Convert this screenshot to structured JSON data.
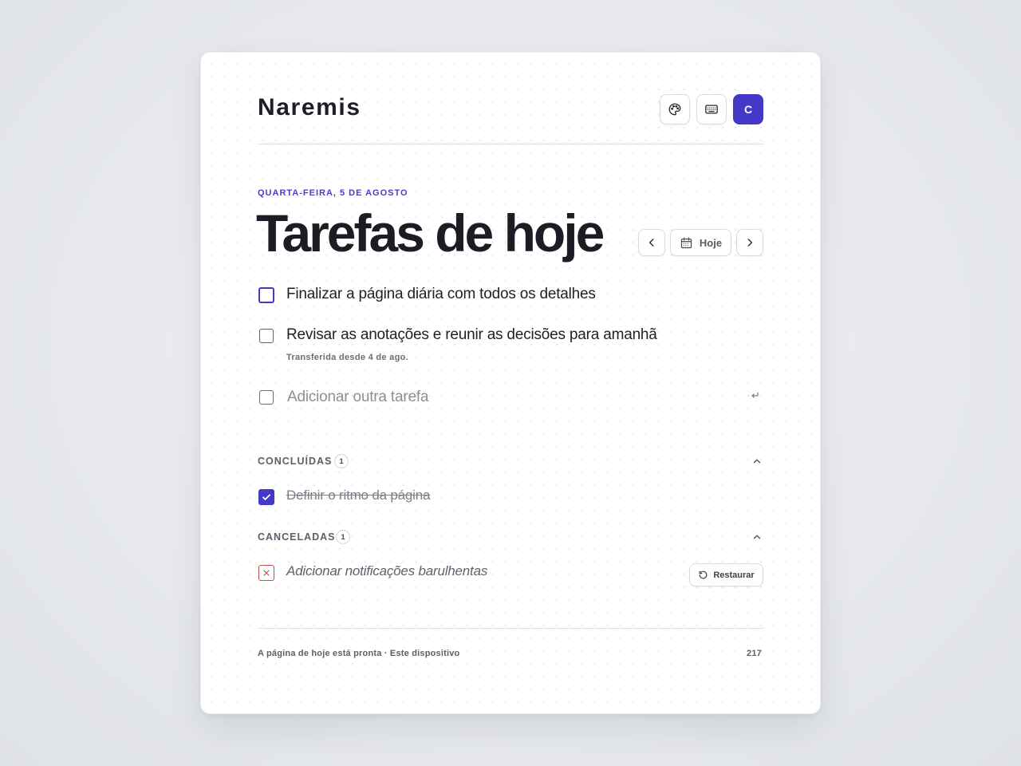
{
  "header": {
    "brand": "Naremis",
    "avatar_initial": "C",
    "icons": [
      "palette-icon",
      "keyboard-icon"
    ]
  },
  "page": {
    "date": "QUARTA-FEIRA, 5 DE AGOSTO",
    "title": "Tarefas de hoje",
    "today_label": "Hoje"
  },
  "tasks": [
    {
      "label": "Finalizar a página diária com todos os detalhes",
      "note": ""
    },
    {
      "label": "Revisar as anotações e reunir as decisões para amanhã",
      "note": "Transferida desde 4 de ago."
    }
  ],
  "new_task": {
    "placeholder": "Adicionar outra tarefa",
    "hint": "↵"
  },
  "completed": {
    "label": "CONCLUÍDAS",
    "count": "1",
    "items": [
      {
        "label": "Definir o ritmo da página"
      }
    ]
  },
  "cancelled": {
    "label": "CANCELADAS",
    "count": "1",
    "items": [
      {
        "label": "Adicionar notificações barulhentas"
      }
    ],
    "restore_label": "Restaurar"
  },
  "footer": {
    "status": "A página de hoje está pronta · Este dispositivo",
    "number": "217"
  },
  "colors": {
    "accent": "#4338c8",
    "cancel": "#c0504d"
  }
}
